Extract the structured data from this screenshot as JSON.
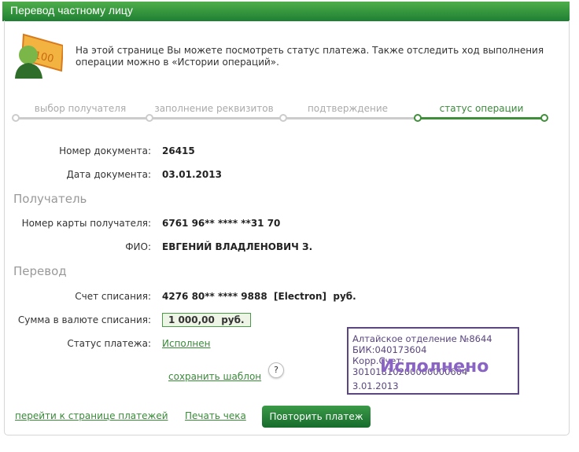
{
  "header": {
    "title": "Перевод частному лицу"
  },
  "intro": "На этой странице Вы можете посмотреть статус платежа. Также отследить ход выполнения операции можно в «Истории операций».",
  "steps": [
    "выбор получателя",
    "заполнение реквизитов",
    "подтверждение",
    "статус операции"
  ],
  "document": {
    "number_label": "Номер документа:",
    "number": "26415",
    "date_label": "Дата документа:",
    "date": "03.01.2013"
  },
  "recipient": {
    "heading": "Получатель",
    "card_label": "Номер карты получателя:",
    "card": "6761 96** **** **31 70",
    "name_label": "ФИО:",
    "name": "ЕВГЕНИЙ ВЛАДЛЕНОВИЧ З."
  },
  "transfer": {
    "heading": "Перевод",
    "account_label": "Счет списания:",
    "account": "4276 80** **** 9888  [Electron]  руб.",
    "amount_label": "Сумма в валюте списания:",
    "amount": "1 000,00  руб.",
    "status_label": "Статус платежа:",
    "status": "Исполнен"
  },
  "save_template": "сохранить шаблон",
  "help": "?",
  "stamp": {
    "line1": "Алтайское отделение №8644",
    "line2": "БИК:040173604",
    "line3": "Корр.Счет: 30101810200000000604",
    "big": "Исполнено",
    "date": "3.01.2013"
  },
  "footer": {
    "payments_link": "перейти к странице платежей",
    "print_link": "Печать чека",
    "repeat_button": "Повторить платеж"
  }
}
